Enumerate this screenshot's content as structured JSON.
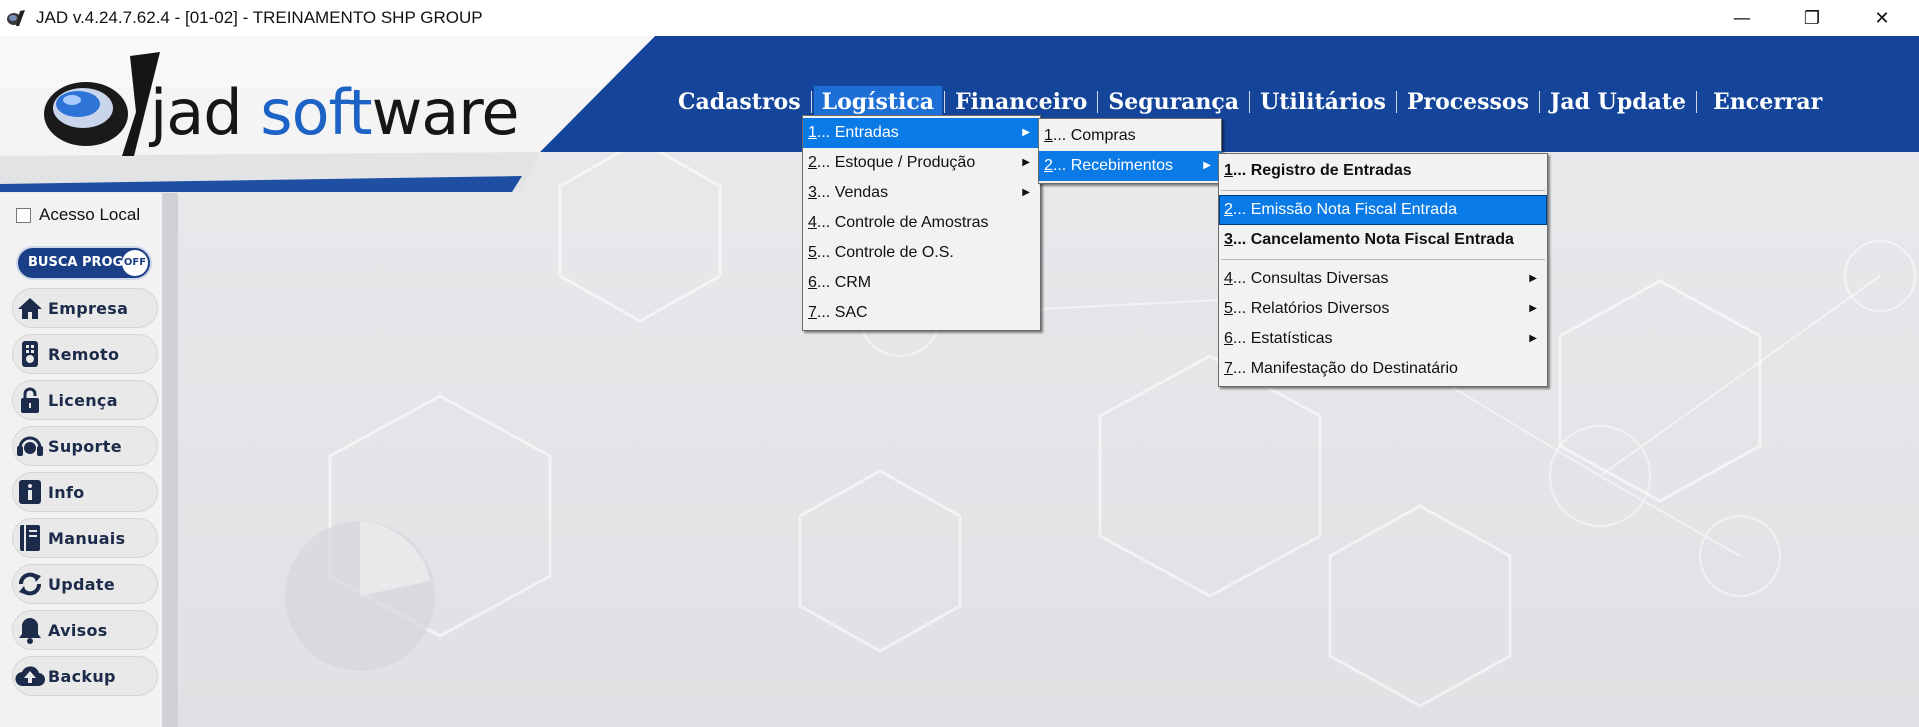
{
  "window": {
    "title": "JAD v.4.24.7.62.4 - [01-02] - TREINAMENTO SHP GROUP",
    "minimize": "—",
    "maximize": "❐",
    "close": "✕"
  },
  "logo": {
    "part1": "jad ",
    "part2": "soft",
    "part3": "ware"
  },
  "nav": [
    {
      "label": "Cadastros",
      "active": false
    },
    {
      "label": "Logística",
      "active": true
    },
    {
      "label": "Financeiro",
      "active": false
    },
    {
      "label": "Segurança",
      "active": false
    },
    {
      "label": "Utilitários",
      "active": false
    },
    {
      "label": "Processos",
      "active": false
    },
    {
      "label": "Jad Update",
      "active": false
    },
    {
      "label": "Encerrar",
      "active": false
    }
  ],
  "sidebar": {
    "local_access": "Acesso Local",
    "busca": "BUSCA PROG.",
    "busca_toggle": "OFF",
    "buttons": [
      {
        "label": "Empresa",
        "icon": "home-icon"
      },
      {
        "label": "Remoto",
        "icon": "remote-icon"
      },
      {
        "label": "Licença",
        "icon": "lock-icon"
      },
      {
        "label": "Suporte",
        "icon": "headset-icon"
      },
      {
        "label": "Info",
        "icon": "info-icon"
      },
      {
        "label": "Manuais",
        "icon": "manual-icon"
      },
      {
        "label": "Update",
        "icon": "refresh-icon"
      },
      {
        "label": "Avisos",
        "icon": "bell-icon"
      },
      {
        "label": "Backup",
        "icon": "cloud-upload-icon"
      }
    ]
  },
  "menu_logistica": [
    {
      "num": "1",
      "label": "... Entradas",
      "submenu": true
    },
    {
      "num": "2",
      "label": "... Estoque / Produção",
      "submenu": true
    },
    {
      "num": "3",
      "label": "... Vendas",
      "submenu": true
    },
    {
      "num": "4",
      "label": "... Controle de Amostras",
      "submenu": false
    },
    {
      "num": "5",
      "label": "... Controle de O.S.",
      "submenu": false
    },
    {
      "num": "6",
      "label": "... CRM",
      "submenu": false
    },
    {
      "num": "7",
      "label": "... SAC",
      "submenu": false
    }
  ],
  "menu_entradas": [
    {
      "num": "1",
      "label": "... Compras",
      "submenu": false
    },
    {
      "num": "2",
      "label": "... Recebimentos",
      "submenu": true
    }
  ],
  "menu_recebimentos": [
    {
      "num": "1",
      "label": "... Registro de Entradas"
    },
    {
      "num": "2",
      "label": "... Emissão Nota Fiscal Entrada"
    },
    {
      "num": "3",
      "label": "... Cancelamento Nota Fiscal Entrada"
    },
    {
      "num": "4",
      "label": "... Consultas Diversas"
    },
    {
      "num": "5",
      "label": "... Relatórios Diversos"
    },
    {
      "num": "6",
      "label": "... Estatísticas"
    },
    {
      "num": "7",
      "label": "... Manifestação do Destinatário"
    }
  ],
  "colors": {
    "nav_bg": "#14459a",
    "nav_active": "#1d6fd6",
    "menu_highlight": "#0a7ae6",
    "brand_blue": "#1d62c5"
  }
}
